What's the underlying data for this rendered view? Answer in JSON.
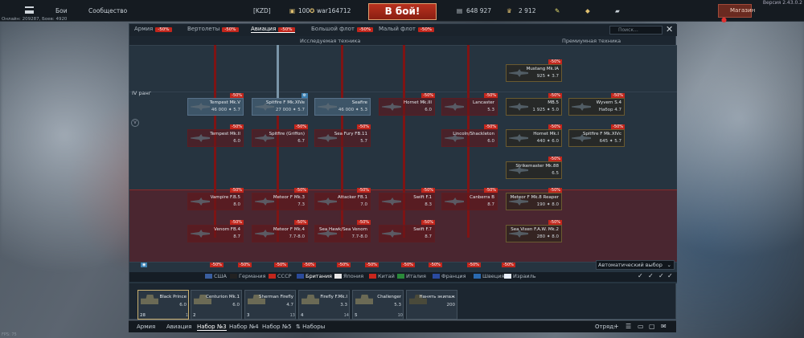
{
  "topbar": {
    "menu_label": "Бои",
    "community_label": "Сообщество",
    "squad_tag": "[KZD]",
    "level": "100",
    "nickname": "war164712",
    "battle_button": "В бой!",
    "silver_lions": "648 927",
    "eagles": "2 912",
    "shop_label": "Магазин",
    "version": "Версия 2.43.0.2",
    "online": "Онлайн: 209287, Боев: 4920",
    "fps": "FPS: 75"
  },
  "tabs": [
    {
      "label": "Армия",
      "discount": "-50%"
    },
    {
      "label": "Вертолеты",
      "discount": "-50%"
    },
    {
      "label": "Авиация",
      "discount": "-50%"
    },
    {
      "label": "Большой флот",
      "discount": "-50%"
    },
    {
      "label": "Малый флот",
      "discount": "-50%"
    }
  ],
  "search_placeholder": "Поиск...",
  "tree_headers": {
    "researched": "Исследуемая техника",
    "premium": "Премиумная техника"
  },
  "ranks": {
    "iv": "IV ранг"
  },
  "aircraft": [
    {
      "name": "Mustang Mk.IA",
      "br": "925 ✦ 3.7",
      "discount": "-50%"
    },
    {
      "name": "Tempest Mk.V",
      "br": "46 000 ✦ 5.7",
      "discount": "-50%"
    },
    {
      "name": "Spitfire F Mk.XIVe",
      "br": "27 000 ✦ 5.7",
      "discount": ""
    },
    {
      "name": "Seafire",
      "br": "46 000 ✦ 5.3",
      "discount": ""
    },
    {
      "name": "Hornet Mk.III",
      "br": "6.0",
      "discount": "-50%"
    },
    {
      "name": "Lancaster",
      "br": "5.3",
      "discount": "-50%"
    },
    {
      "name": "MB.5",
      "br": "1 925 ✦ 5.0",
      "discount": "-50%"
    },
    {
      "name": "Wyvern S.4",
      "br": "Набор 4.7",
      "discount": "-50%"
    },
    {
      "name": "Tempest Mk.II",
      "br": "6.0",
      "discount": "-50%"
    },
    {
      "name": "Spitfire (Griffon)",
      "br": "6.7",
      "discount": "-50%"
    },
    {
      "name": "Sea Fury FB.11",
      "br": "5.7",
      "discount": "-50%"
    },
    {
      "name": "Lincoln/Shackleton",
      "br": "6.0",
      "discount": "-50%"
    },
    {
      "name": "Hornet Mk.I",
      "br": "440 ✦ 6.0",
      "discount": "-50%"
    },
    {
      "name": "Spitfire F Mk.XIVc",
      "br": "645 ✦ 5.7",
      "discount": "-50%"
    },
    {
      "name": "Strikemaster Mk.88",
      "br": "6.5",
      "discount": "-50%"
    },
    {
      "name": "Vampire F.B.5",
      "br": "8.0",
      "discount": "-50%"
    },
    {
      "name": "Meteor F Mk.3",
      "br": "7.3",
      "discount": "-50%"
    },
    {
      "name": "Attacker FB.1",
      "br": "7.0",
      "discount": "-50%"
    },
    {
      "name": "Swift F.1",
      "br": "8.3",
      "discount": "-50%"
    },
    {
      "name": "Canberra B",
      "br": "8.7",
      "discount": "-50%"
    },
    {
      "name": "Meteor F Mk.8 Reaper",
      "br": "190 ✦ 8.0",
      "discount": "-50%"
    },
    {
      "name": "Venom FB.4",
      "br": "8.7",
      "discount": "-50%"
    },
    {
      "name": "Meteor F Mk.4",
      "br": "7.7-8.0",
      "discount": "-50%"
    },
    {
      "name": "Sea Hawk/Sea Venom",
      "br": "7.7-8.0",
      "discount": "-50%"
    },
    {
      "name": "Swift F.7",
      "br": "8.7",
      "discount": "-50%"
    },
    {
      "name": "Sea Vixen F.A.W. Mk.2",
      "br": "280 ✦ 8.0",
      "discount": "-50%"
    }
  ],
  "row_discounts": [
    "-50%",
    "-50%",
    "-50%",
    "-50%",
    "-50%",
    "-50%",
    "-50%",
    "-50%",
    "-50%",
    "-50%",
    "-50%",
    "-50%",
    "-50%",
    "-50%",
    "-50%",
    "-50%",
    "-50%",
    "-50%",
    "-50%",
    "-50%",
    "-50%"
  ],
  "auto_select": "Автоматический выбор",
  "nations": [
    {
      "label": "США",
      "color": "#3a5fa0"
    },
    {
      "label": "Германия",
      "color": "#222222"
    },
    {
      "label": "СССР",
      "color": "#c2261c"
    },
    {
      "label": "Британия",
      "color": "#2a4a9a"
    },
    {
      "label": "Япония",
      "color": "#e8e8e8"
    },
    {
      "label": "Китай",
      "color": "#c8261c"
    },
    {
      "label": "Италия",
      "color": "#2a8a3a"
    },
    {
      "label": "Франция",
      "color": "#2a4aa0"
    },
    {
      "label": "Швеция",
      "color": "#2a6ab0"
    },
    {
      "label": "Израиль",
      "color": "#e8f0ff"
    }
  ],
  "crew": [
    {
      "name": "Black Prince",
      "br": "6.0",
      "foot_left": "28",
      "foot_right": "1"
    },
    {
      "name": "Centurion Mk.1",
      "br": "6.0",
      "foot_left": "2",
      "foot_right": ""
    },
    {
      "name": "Sherman Firefly",
      "br": "4.7",
      "foot_left": "3",
      "foot_right": "13"
    },
    {
      "name": "Firefly F.Mk.I",
      "br": "3.3",
      "foot_left": "4",
      "foot_right": "14"
    },
    {
      "name": "Challenger",
      "br": "5.3",
      "foot_left": "5",
      "foot_right": "10"
    },
    {
      "name": "Нанять экипаж",
      "br": "200",
      "foot_left": "",
      "foot_right": ""
    }
  ],
  "bottombar": {
    "tabs": [
      "Армия",
      "Авиация",
      "Набор №3",
      "Набор №4",
      "Набор №5",
      "Наборы"
    ],
    "squad_label": "Отряд:"
  }
}
